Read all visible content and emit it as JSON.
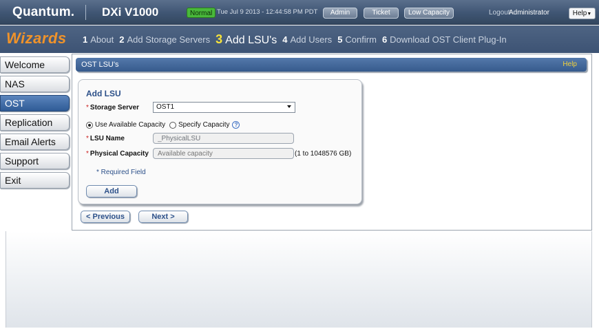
{
  "header": {
    "brand": "Quantum.",
    "model": "DXi V1000",
    "status_badge": "Normal",
    "datetime": "Tue Jul 9 2013 - 12:44:58 PM PDT",
    "buttons": {
      "admin": "Admin",
      "ticket": "Ticket",
      "low_capacity": "Low Capacity"
    },
    "logout": "Logout",
    "user": "Administrator",
    "help": "Help"
  },
  "wizard": {
    "title": "Wizards",
    "steps": [
      {
        "num": "1",
        "label": "About"
      },
      {
        "num": "2",
        "label": "Add Storage Servers"
      },
      {
        "num": "3",
        "label": "Add LSU's",
        "current": true
      },
      {
        "num": "4",
        "label": "Add Users"
      },
      {
        "num": "5",
        "label": "Confirm"
      },
      {
        "num": "6",
        "label": "Download OST Client Plug-In"
      }
    ]
  },
  "sidebar": {
    "items": [
      {
        "label": "Welcome"
      },
      {
        "label": "NAS"
      },
      {
        "label": "OST",
        "active": true
      },
      {
        "label": "Replication"
      },
      {
        "label": "Email Alerts"
      },
      {
        "label": "Support"
      },
      {
        "label": "Exit"
      }
    ]
  },
  "panel": {
    "title": "OST LSU's",
    "help": "Help"
  },
  "form": {
    "title": "Add LSU",
    "required_mark": "*",
    "storage_server_label": "Storage Server",
    "storage_server_value": "OST1",
    "radio_available": "Use Available Capacity",
    "radio_specify": "Specify Capacity",
    "help_mark": "?",
    "lsu_name_label": "LSU Name",
    "lsu_name_value": "_PhysicalLSU",
    "physical_capacity_label": "Physical Capacity",
    "physical_capacity_placeholder": "Available capacity",
    "range_note": "(1 to 1048576 GB)",
    "required_note": "* Required Field",
    "add_button": "Add"
  },
  "nav_buttons": {
    "previous": "< Previous",
    "next": "Next >"
  }
}
